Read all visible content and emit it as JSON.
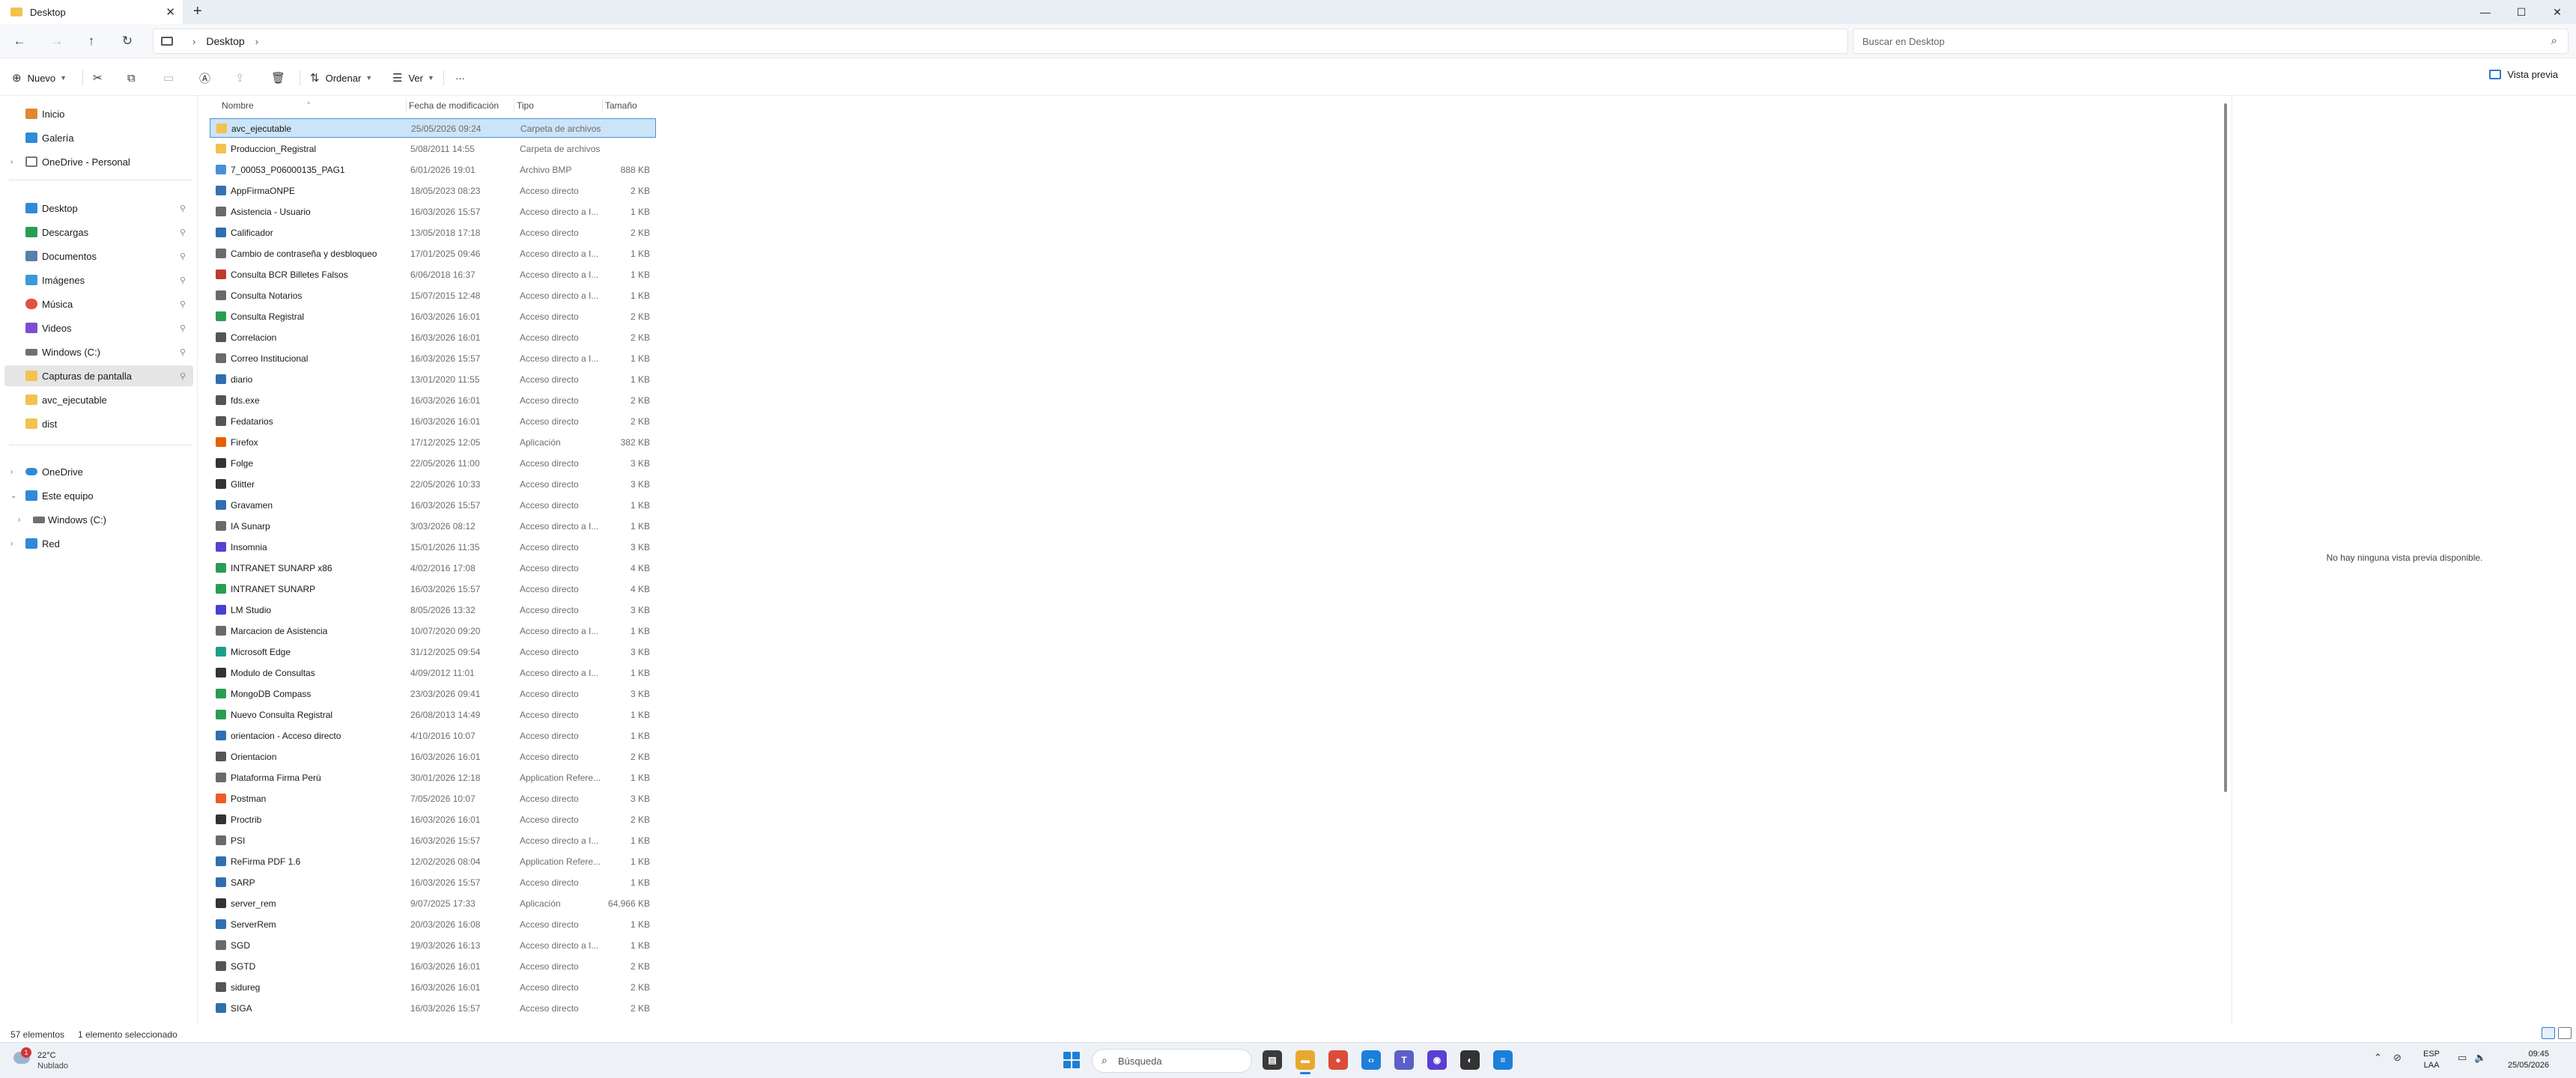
{
  "window": {
    "tab_title": "Desktop",
    "new_tab": "+",
    "controls": {
      "minimize": "—",
      "maximize": "☐",
      "close": "✕"
    }
  },
  "address": {
    "path": [
      "Desktop"
    ],
    "search_placeholder": "Buscar en Desktop"
  },
  "toolbar": {
    "new_label": "Nuevo",
    "sort_label": "Ordenar",
    "view_label": "Ver",
    "more_label": "···",
    "preview_label": "Vista previa"
  },
  "sidebar": {
    "top": [
      {
        "label": "Inicio",
        "icon": "home-icon",
        "color": "#e0882e"
      },
      {
        "label": "Galería",
        "icon": "gallery-icon",
        "color": "#2f8ad8"
      },
      {
        "label": "OneDrive - Personal",
        "icon": "document-icon",
        "color": "#777777"
      }
    ],
    "quick": [
      {
        "label": "Desktop",
        "icon": "desktop-icon",
        "color": "#2f8ad8"
      },
      {
        "label": "Descargas",
        "icon": "download-icon",
        "color": "#2a9d54"
      },
      {
        "label": "Documentos",
        "icon": "documents-icon",
        "color": "#5b7fa8"
      },
      {
        "label": "Imágenes",
        "icon": "pictures-icon",
        "color": "#3b9ad9"
      },
      {
        "label": "Música",
        "icon": "music-icon",
        "color": "#e2513f"
      },
      {
        "label": "Videos",
        "icon": "videos-icon",
        "color": "#7a4fd1"
      },
      {
        "label": "Windows (C:)",
        "icon": "drive-icon",
        "color": "#707070"
      },
      {
        "label": "Capturas de pantalla",
        "icon": "folder-icon",
        "color": "#f3c24f"
      },
      {
        "label": "avc_ejecutable",
        "icon": "folder-icon",
        "color": "#f3c24f"
      },
      {
        "label": "dist",
        "icon": "folder-icon",
        "color": "#f3c24f"
      }
    ],
    "bottom": [
      {
        "label": "OneDrive",
        "icon": "cloud-icon",
        "color": "#2f8ad8"
      },
      {
        "label": "Este equipo",
        "icon": "computer-icon",
        "color": "#2f8ad8"
      },
      {
        "label": "Windows (C:)",
        "icon": "drive-icon",
        "color": "#707070"
      },
      {
        "label": "Red",
        "icon": "network-icon",
        "color": "#2f8ad8"
      }
    ]
  },
  "columns": {
    "name": "Nombre",
    "date": "Fecha de modificación",
    "type": "Tipo",
    "size": "Tamaño"
  },
  "files": [
    {
      "name": "avc_ejecutable",
      "date": "25/05/2026 09:24",
      "type": "Carpeta de archivos",
      "size": "",
      "color": "#f3c24f"
    },
    {
      "name": "Produccion_Registral",
      "date": "5/08/2011 14:55",
      "type": "Carpeta de archivos",
      "size": "",
      "color": "#f3c24f"
    },
    {
      "name": "7_00053_P06000135_PAG1",
      "date": "6/01/2026 19:01",
      "type": "Archivo BMP",
      "size": "888 KB",
      "color": "#4a90d9"
    },
    {
      "name": "AppFirmaONPE",
      "date": "18/05/2023 08:23",
      "type": "Acceso directo",
      "size": "2 KB",
      "color": "#3572b0"
    },
    {
      "name": "Asistencia - Usuario",
      "date": "16/03/2026 15:57",
      "type": "Acceso directo a I...",
      "size": "1 KB",
      "color": "#6a6a6a"
    },
    {
      "name": "Calificador",
      "date": "13/05/2018 17:18",
      "type": "Acceso directo",
      "size": "2 KB",
      "color": "#2f6fb0"
    },
    {
      "name": "Cambio de contraseña y desbloqueo",
      "date": "17/01/2025 09:46",
      "type": "Acceso directo a I...",
      "size": "1 KB",
      "color": "#6a6a6a"
    },
    {
      "name": "Consulta BCR Billetes Falsos",
      "date": "6/06/2018 16:37",
      "type": "Acceso directo a I...",
      "size": "1 KB",
      "color": "#c0392b"
    },
    {
      "name": "Consulta Notarios",
      "date": "15/07/2015 12:48",
      "type": "Acceso directo a I...",
      "size": "1 KB",
      "color": "#6a6a6a"
    },
    {
      "name": "Consulta Registral",
      "date": "16/03/2026 16:01",
      "type": "Acceso directo",
      "size": "2 KB",
      "color": "#2a9d54"
    },
    {
      "name": "Correlacion",
      "date": "16/03/2026 16:01",
      "type": "Acceso directo",
      "size": "2 KB",
      "color": "#555555"
    },
    {
      "name": "Correo Institucional",
      "date": "16/03/2026 15:57",
      "type": "Acceso directo a I...",
      "size": "1 KB",
      "color": "#6a6a6a"
    },
    {
      "name": "diario",
      "date": "13/01/2020 11:55",
      "type": "Acceso directo",
      "size": "1 KB",
      "color": "#2f6fb0"
    },
    {
      "name": "fds.exe",
      "date": "16/03/2026 16:01",
      "type": "Acceso directo",
      "size": "2 KB",
      "color": "#555555"
    },
    {
      "name": "Fedatarios",
      "date": "16/03/2026 16:01",
      "type": "Acceso directo",
      "size": "2 KB",
      "color": "#555555"
    },
    {
      "name": "Firefox",
      "date": "17/12/2025 12:05",
      "type": "Aplicación",
      "size": "382 KB",
      "color": "#e66000"
    },
    {
      "name": "Folge",
      "date": "22/05/2026 11:00",
      "type": "Acceso directo",
      "size": "3 KB",
      "color": "#333333"
    },
    {
      "name": "Glitter",
      "date": "22/05/2026 10:33",
      "type": "Acceso directo",
      "size": "3 KB",
      "color": "#333333"
    },
    {
      "name": "Gravamen",
      "date": "16/03/2026 15:57",
      "type": "Acceso directo",
      "size": "1 KB",
      "color": "#2f6fb0"
    },
    {
      "name": "IA Sunarp",
      "date": "3/03/2026 08:12",
      "type": "Acceso directo a I...",
      "size": "1 KB",
      "color": "#6a6a6a"
    },
    {
      "name": "Insomnia",
      "date": "15/01/2026 11:35",
      "type": "Acceso directo",
      "size": "3 KB",
      "color": "#5b3fd1"
    },
    {
      "name": "INTRANET SUNARP x86",
      "date": "4/02/2016 17:08",
      "type": "Acceso directo",
      "size": "4 KB",
      "color": "#2a9d54"
    },
    {
      "name": "INTRANET SUNARP",
      "date": "16/03/2026 15:57",
      "type": "Acceso directo",
      "size": "4 KB",
      "color": "#2a9d54"
    },
    {
      "name": "LM Studio",
      "date": "8/05/2026 13:32",
      "type": "Acceso directo",
      "size": "3 KB",
      "color": "#4a3fd1"
    },
    {
      "name": "Marcacion de Asistencia",
      "date": "10/07/2020 09:20",
      "type": "Acceso directo a I...",
      "size": "1 KB",
      "color": "#6a6a6a"
    },
    {
      "name": "Microsoft Edge",
      "date": "31/12/2025 09:54",
      "type": "Acceso directo",
      "size": "3 KB",
      "color": "#1e9e8a"
    },
    {
      "name": "Modulo de Consultas",
      "date": "4/09/2012 11:01",
      "type": "Acceso directo a I...",
      "size": "1 KB",
      "color": "#333333"
    },
    {
      "name": "MongoDB Compass",
      "date": "23/03/2026 09:41",
      "type": "Acceso directo",
      "size": "3 KB",
      "color": "#2a9d54"
    },
    {
      "name": "Nuevo Consulta Registral",
      "date": "26/08/2013 14:49",
      "type": "Acceso directo",
      "size": "1 KB",
      "color": "#2a9d54"
    },
    {
      "name": "orientacion - Acceso directo",
      "date": "4/10/2016 10:07",
      "type": "Acceso directo",
      "size": "1 KB",
      "color": "#2f6fb0"
    },
    {
      "name": "Orientacion",
      "date": "16/03/2026 16:01",
      "type": "Acceso directo",
      "size": "2 KB",
      "color": "#555555"
    },
    {
      "name": "Plataforma Firma Perú",
      "date": "30/01/2026 12:18",
      "type": "Application Refere...",
      "size": "1 KB",
      "color": "#6a6a6a"
    },
    {
      "name": "Postman",
      "date": "7/05/2026 10:07",
      "type": "Acceso directo",
      "size": "3 KB",
      "color": "#ef5b25"
    },
    {
      "name": "Proctrib",
      "date": "16/03/2026 16:01",
      "type": "Acceso directo",
      "size": "2 KB",
      "color": "#333333"
    },
    {
      "name": "PSI",
      "date": "16/03/2026 15:57",
      "type": "Acceso directo a I...",
      "size": "1 KB",
      "color": "#6a6a6a"
    },
    {
      "name": "ReFirma PDF 1.6",
      "date": "12/02/2026 08:04",
      "type": "Application Refere...",
      "size": "1 KB",
      "color": "#2f6fb0"
    },
    {
      "name": "SARP",
      "date": "16/03/2026 15:57",
      "type": "Acceso directo",
      "size": "1 KB",
      "color": "#2f6fb0"
    },
    {
      "name": "server_rem",
      "date": "9/07/2025 17:33",
      "type": "Aplicación",
      "size": "64,966 KB",
      "color": "#333333"
    },
    {
      "name": "ServerRem",
      "date": "20/03/2026 16:08",
      "type": "Acceso directo",
      "size": "1 KB",
      "color": "#2f6fb0"
    },
    {
      "name": "SGD",
      "date": "19/03/2026 16:13",
      "type": "Acceso directo a I...",
      "size": "1 KB",
      "color": "#6a6a6a"
    },
    {
      "name": "SGTD",
      "date": "16/03/2026 16:01",
      "type": "Acceso directo",
      "size": "2 KB",
      "color": "#555555"
    },
    {
      "name": "sidureg",
      "date": "16/03/2026 16:01",
      "type": "Acceso directo",
      "size": "2 KB",
      "color": "#555555"
    },
    {
      "name": "SIGA",
      "date": "16/03/2026 15:57",
      "type": "Acceso directo",
      "size": "2 KB",
      "color": "#2f6fb0"
    }
  ],
  "preview": {
    "message": "No hay ninguna vista previa disponible."
  },
  "status": {
    "count": "57 elementos",
    "selected": "1 elemento seleccionado"
  },
  "taskbar": {
    "weather_temp": "22°C",
    "weather_desc": "Nublado",
    "weather_badge": "1",
    "search_placeholder": "Búsqueda",
    "apps": [
      {
        "name": "file-manager-app",
        "color": "#3a3a3a",
        "glyph": "▤"
      },
      {
        "name": "file-explorer-app",
        "color": "#e8a82f",
        "glyph": "▬",
        "active": true
      },
      {
        "name": "chrome-app",
        "color": "#dd4b39",
        "glyph": "●"
      },
      {
        "name": "vscode-app",
        "color": "#1c7fd9",
        "glyph": "‹›"
      },
      {
        "name": "teams-app",
        "color": "#5b5fc7",
        "glyph": "T"
      },
      {
        "name": "insomnia-app",
        "color": "#5b3fd1",
        "glyph": "◉"
      },
      {
        "name": "folge-app",
        "color": "#333333",
        "glyph": "◐"
      },
      {
        "name": "notepad-app",
        "color": "#1c7fd9",
        "glyph": "≡"
      }
    ],
    "lang_top": "ESP",
    "lang_bottom": "LAA",
    "time": "09:45",
    "date": "25/05/2026"
  }
}
